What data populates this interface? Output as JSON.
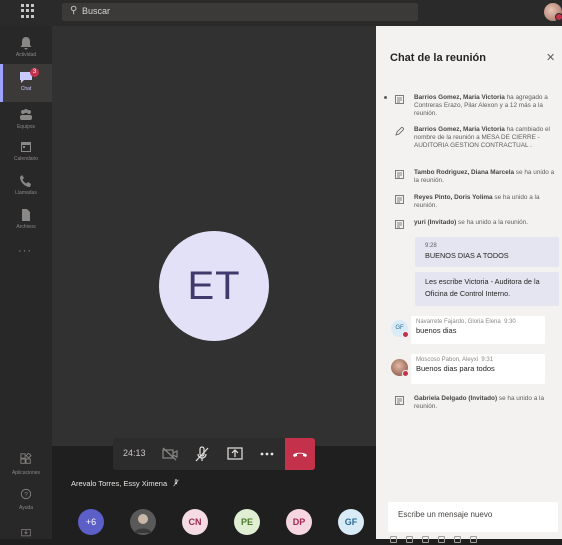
{
  "topbar": {
    "search_placeholder": "Buscar"
  },
  "rail": {
    "items": [
      {
        "label": "Actividad",
        "icon": "bell-icon"
      },
      {
        "label": "Chat",
        "icon": "chat-icon",
        "badge": "3"
      },
      {
        "label": "Equipos",
        "icon": "teams-icon"
      },
      {
        "label": "Calendario",
        "icon": "calendar-icon"
      },
      {
        "label": "Llamadas",
        "icon": "phone-icon"
      },
      {
        "label": "Archivos",
        "icon": "files-icon"
      }
    ],
    "more": "···",
    "apps_label": "Aplicaciones",
    "help_label": "Ayuda"
  },
  "call": {
    "avatar_initials": "ET",
    "duration": "24:13",
    "speaker_name": "Arevalo Torres, Essy Ximena",
    "more_count": "+6",
    "participants": [
      {
        "initials": "",
        "bg": "#6b6a69",
        "color": "#ffffff",
        "photo": true
      },
      {
        "initials": "CN",
        "bg": "#f4dbe4",
        "color": "#9b2b52"
      },
      {
        "initials": "PE",
        "bg": "#e0efd4",
        "color": "#4b7a2b"
      },
      {
        "initials": "DP",
        "bg": "#f6d6e0",
        "color": "#a3274f"
      },
      {
        "initials": "GF",
        "bg": "#d9ebf6",
        "color": "#2b6a94"
      }
    ]
  },
  "chat": {
    "title": "Chat de la reunión",
    "events": [
      {
        "name": "Barrios Gomez, Maria Victoria",
        "text": " ha agregado a Contreras Erazo, Pilar Alexon y a 12 más a la reunión."
      },
      {
        "name": "Barrios Gomez, Maria Victoria",
        "text": " ha cambiado el nombre de la reunión a MESA DE CIERRE - AUDITORIA GESTION CONTRACTUAL ."
      },
      {
        "name": "Tambo Rodriguez, Diana Marcela",
        "text": " se ha unido a la reunión."
      },
      {
        "name": "Reyes Pinto, Doris Yolima",
        "text": " se ha unido a la reunión."
      },
      {
        "name": "yuri (Invitado)",
        "text": " se ha unido a la reunión."
      }
    ],
    "my_message": {
      "time": "9:28",
      "text1": "BUENOS DIAS A TODOS",
      "text2": "Les escribe Victoria - Auditora de la Oficina de Control Interno."
    },
    "messages": [
      {
        "initials": "GF",
        "author": "Navarrete Fajardo, Gloria Elena",
        "time": "9:30",
        "text": "buenos dias"
      },
      {
        "initials": "",
        "author": "Moscoso Pabon, Aleyxi",
        "time": "9:31",
        "text": "Buenos dias para todos"
      }
    ],
    "last_event": {
      "name": "Gabriela Delgado (Invitado)",
      "text": " se ha unido a la reunión."
    },
    "compose_placeholder": "Escribe un mensaje nuevo"
  },
  "colors": {
    "accent": "#5b5fc7",
    "hangup": "#c4314b",
    "rail_active": "#9ea2ff"
  }
}
